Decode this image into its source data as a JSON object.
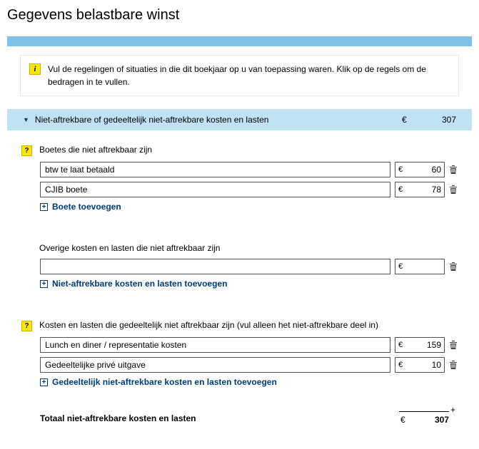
{
  "page_title": "Gegevens belastbare winst",
  "info_text": "Vul de regelingen of situaties in die dit boekjaar op u van toepassing waren. Klik op de regels om de bedragen in te vullen.",
  "accordion": {
    "title": "Niet-aftrekbare of gedeeltelijk niet-aftrekbare kosten en lasten",
    "currency": "€",
    "amount": "307"
  },
  "currency_symbol": "€",
  "sections": {
    "boetes": {
      "title": "Boetes die niet aftrekbaar zijn",
      "rows": [
        {
          "desc": "btw te laat betaald",
          "amount": "60"
        },
        {
          "desc": "CJIB boete",
          "amount": "78"
        }
      ],
      "add_label": "Boete toevoegen"
    },
    "overige": {
      "title": "Overige kosten en lasten die niet aftrekbaar zijn",
      "rows": [
        {
          "desc": "",
          "amount": ""
        }
      ],
      "add_label": "Niet-aftrekbare kosten en lasten toevoegen"
    },
    "gedeeltelijk": {
      "title": "Kosten en lasten die gedeeltelijk niet aftrekbaar zijn (vul alleen het niet-aftrekbare deel in)",
      "rows": [
        {
          "desc": "Lunch en diner / representatie kosten",
          "amount": "159"
        },
        {
          "desc": "Gedeeltelijke privé uitgave",
          "amount": "10"
        }
      ],
      "add_label": "Gedeeltelijk niet-aftrekbare kosten en lasten toevoegen"
    }
  },
  "total": {
    "label": "Totaal niet-aftrekbare kosten en lasten",
    "currency": "€",
    "amount": "307"
  }
}
